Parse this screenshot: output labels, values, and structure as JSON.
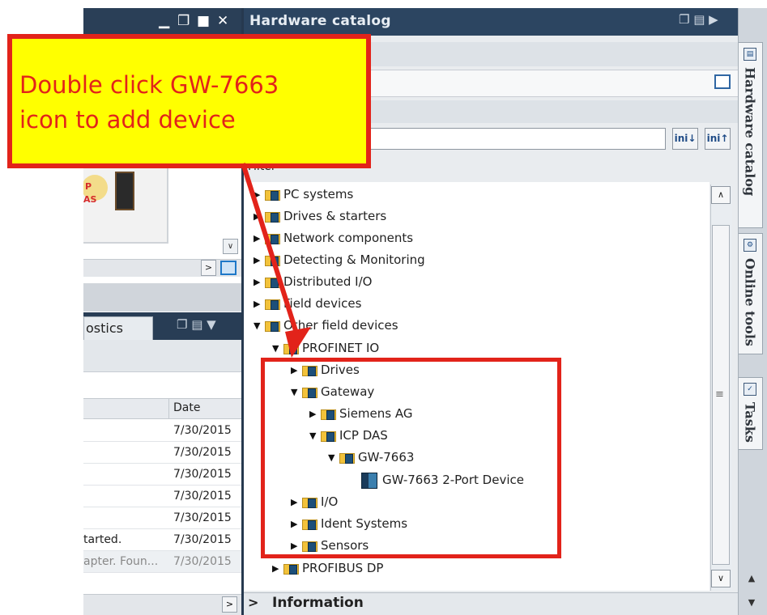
{
  "annotation": {
    "callout_text": "Double click GW-7663\nicon to add device",
    "color": "#e2231a",
    "callout_background": "#ffff00"
  },
  "left_panel": {
    "window_controls": [
      "minimize-icon",
      "restore-icon",
      "maximize-icon",
      "close-icon"
    ],
    "diagnostics_tab_label": "ostics",
    "table": {
      "date_header": "Date",
      "rows": [
        {
          "message": "",
          "date": "7/30/2015"
        },
        {
          "message": "",
          "date": "7/30/2015"
        },
        {
          "message": "",
          "date": "7/30/2015"
        },
        {
          "message": "",
          "date": "7/30/2015"
        },
        {
          "message": "",
          "date": "7/30/2015"
        },
        {
          "message": "tarted.",
          "date": "7/30/2015"
        },
        {
          "message": "apter. Foun...",
          "date": "7/30/2015"
        }
      ]
    }
  },
  "catalog": {
    "title": "Hardware catalog",
    "filter_label": "Filter",
    "search_value": "",
    "tree": [
      {
        "label": "PC systems",
        "expanded": false
      },
      {
        "label": "Drives & starters",
        "expanded": false
      },
      {
        "label": "Network components",
        "expanded": false
      },
      {
        "label": "Detecting & Monitoring",
        "expanded": false
      },
      {
        "label": "Distributed I/O",
        "expanded": false
      },
      {
        "label": "Field devices",
        "expanded": false
      },
      {
        "label": "Other field devices",
        "expanded": true
      },
      {
        "label": "PROFINET IO",
        "expanded": true
      },
      {
        "label": "Drives",
        "expanded": false
      },
      {
        "label": "Gateway",
        "expanded": true
      },
      {
        "label": "Siemens AG",
        "expanded": false
      },
      {
        "label": "ICP DAS",
        "expanded": true
      },
      {
        "label": "GW-7663",
        "expanded": true
      },
      {
        "label": "GW-7663 2-Port Device",
        "type": "device"
      },
      {
        "label": "I/O",
        "expanded": false
      },
      {
        "label": "Ident Systems",
        "expanded": false
      },
      {
        "label": "Sensors",
        "expanded": false
      },
      {
        "label": "PROFIBUS DP",
        "expanded": false
      }
    ],
    "info_label": "Information"
  },
  "right_tabs": [
    {
      "label": "Hardware catalog",
      "icon": "catalog-icon"
    },
    {
      "label": "Online tools",
      "icon": "online-tools-icon"
    },
    {
      "label": "Tasks",
      "icon": "tasks-icon"
    }
  ]
}
